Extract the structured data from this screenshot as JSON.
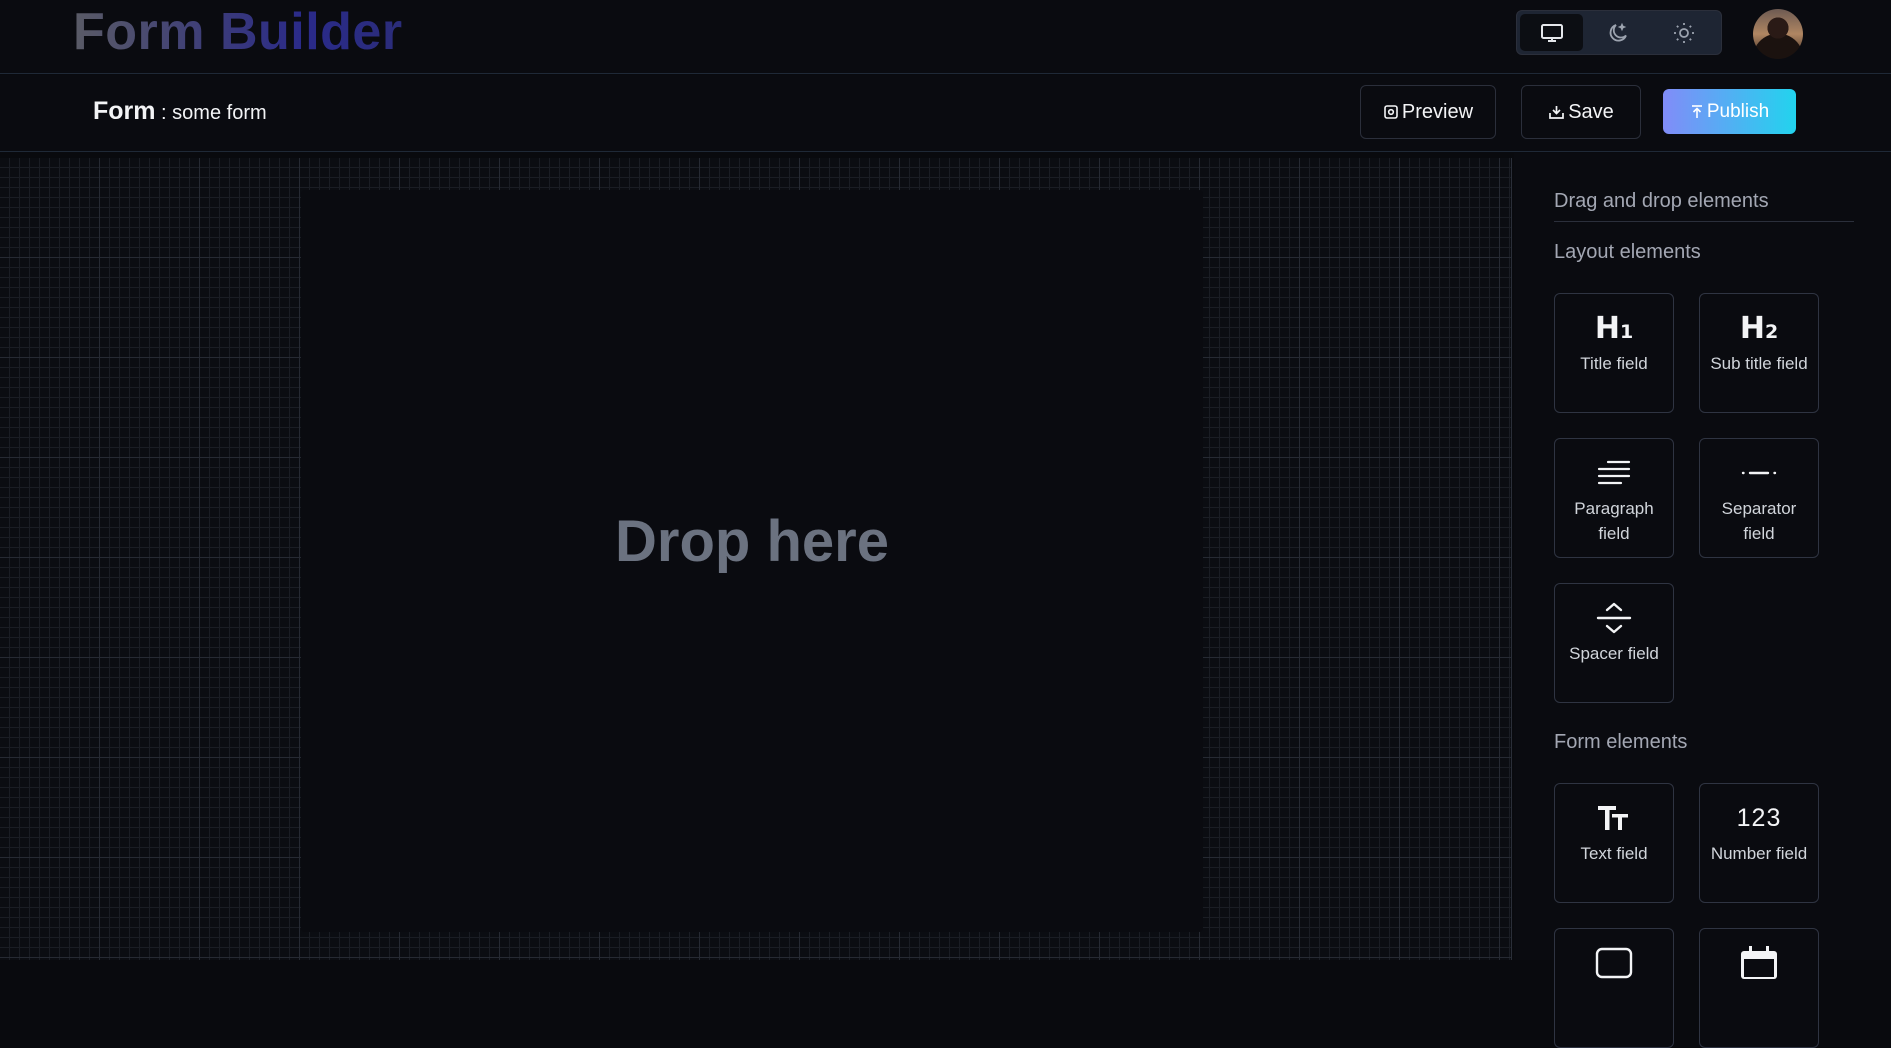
{
  "app": {
    "brand": "Form Builder",
    "theme_modes": [
      {
        "name": "system",
        "icon": "monitor-icon",
        "active": true
      },
      {
        "name": "dark",
        "icon": "moon-icon",
        "active": false
      },
      {
        "name": "light",
        "icon": "sun-icon",
        "active": false
      }
    ]
  },
  "header": {
    "title_label": "Form",
    "title_sep": " : ",
    "form_name": "some form",
    "preview_label": "Preview",
    "save_label": "Save",
    "publish_label": "Publish"
  },
  "canvas": {
    "drop_text": "Drop here"
  },
  "sidebar": {
    "heading": "Drag and drop elements",
    "layout_section": "Layout elements",
    "layout_items": [
      {
        "label": "Title field",
        "icon": "h1-icon"
      },
      {
        "label": "Sub title field",
        "icon": "h2-icon"
      },
      {
        "label": "Paragraph field",
        "icon": "paragraph-icon"
      },
      {
        "label": "Separator field",
        "icon": "separator-icon"
      },
      {
        "label": "Spacer field",
        "icon": "spacer-icon"
      }
    ],
    "form_section": "Form elements",
    "form_items": [
      {
        "label": "Text field",
        "icon": "text-icon",
        "glyph": "Tт"
      },
      {
        "label": "Number field",
        "icon": "number-icon",
        "glyph": "123"
      },
      {
        "label": "",
        "icon": "textarea-icon"
      },
      {
        "label": "",
        "icon": "calendar-icon"
      }
    ]
  },
  "colors": {
    "background": "#090a0e",
    "accent_start": "#818cf8",
    "accent_end": "#22d3ee"
  }
}
